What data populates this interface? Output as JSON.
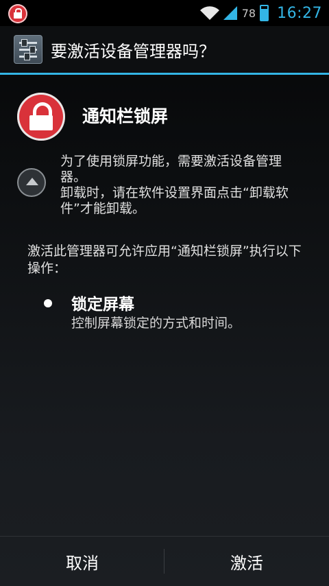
{
  "status_bar": {
    "app_icon": "lock-icon",
    "wifi_icon": "wifi-icon",
    "signal_icon": "signal-icon",
    "battery_level": "78",
    "battery_fraction": 0.78,
    "time": "16:27",
    "accent_color": "#33b5e5"
  },
  "title_bar": {
    "icon": "settings-sliders-icon",
    "title": "要激活设备管理器吗？"
  },
  "app": {
    "icon": "lock-icon",
    "icon_color": "#d9323a",
    "name": "通知栏锁屏"
  },
  "description": {
    "toggle_icon": "chevron-up-icon",
    "line1": "为了使用锁屏功能，需要激活设备管理器。",
    "line2": "卸载时，请在软件设置界面点击“卸载软件”才能卸载。"
  },
  "warning": "激活此管理器可允许应用“通知栏锁屏”执行以下操作：",
  "policies": [
    {
      "title": "锁定屏幕",
      "description": "控制屏幕锁定的方式和时间。"
    }
  ],
  "buttons": {
    "cancel": "取消",
    "activate": "激活"
  }
}
